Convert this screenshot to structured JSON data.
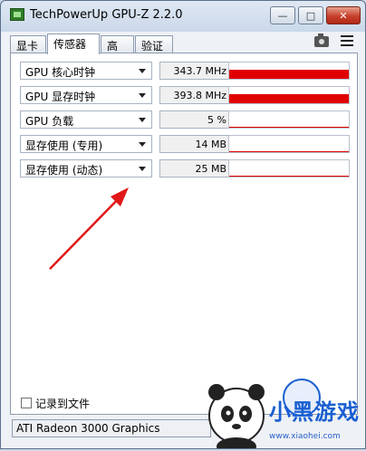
{
  "window": {
    "title": "TechPowerUp GPU-Z 2.2.0",
    "minimize": "—",
    "maximize": "□",
    "close": "✕"
  },
  "tabs": [
    {
      "label": "显卡",
      "active": false
    },
    {
      "label": "传感器",
      "active": true
    },
    {
      "label": "高级",
      "active": false
    },
    {
      "label": "验证",
      "active": false
    }
  ],
  "toolbar_icons": [
    "camera-icon",
    "menu-icon"
  ],
  "sensors": [
    {
      "label": "GPU 核心时钟",
      "value": "343.7 MHz",
      "graph_level": 0.55
    },
    {
      "label": "GPU 显存时钟",
      "value": "393.8 MHz",
      "graph_level": 0.55
    },
    {
      "label": "GPU 负载",
      "value": "5 %",
      "graph_level": 0.05
    },
    {
      "label": "显存使用 (专用)",
      "value": "14 MB",
      "graph_level": 0.05
    },
    {
      "label": "显存使用 (动态)",
      "value": "25 MB",
      "graph_level": 0.05
    }
  ],
  "log_to_file": {
    "label": "记录到文件",
    "checked": false
  },
  "gpu_selector": {
    "value": "ATI Radeon 3000 Graphics"
  },
  "annotation_arrow": {
    "color": "#e01818"
  },
  "watermark": {
    "text": "小黑游戏",
    "url": "www.xiaohei.com"
  },
  "colors": {
    "graph": "#e00000",
    "accent": "#1a5fd1"
  }
}
